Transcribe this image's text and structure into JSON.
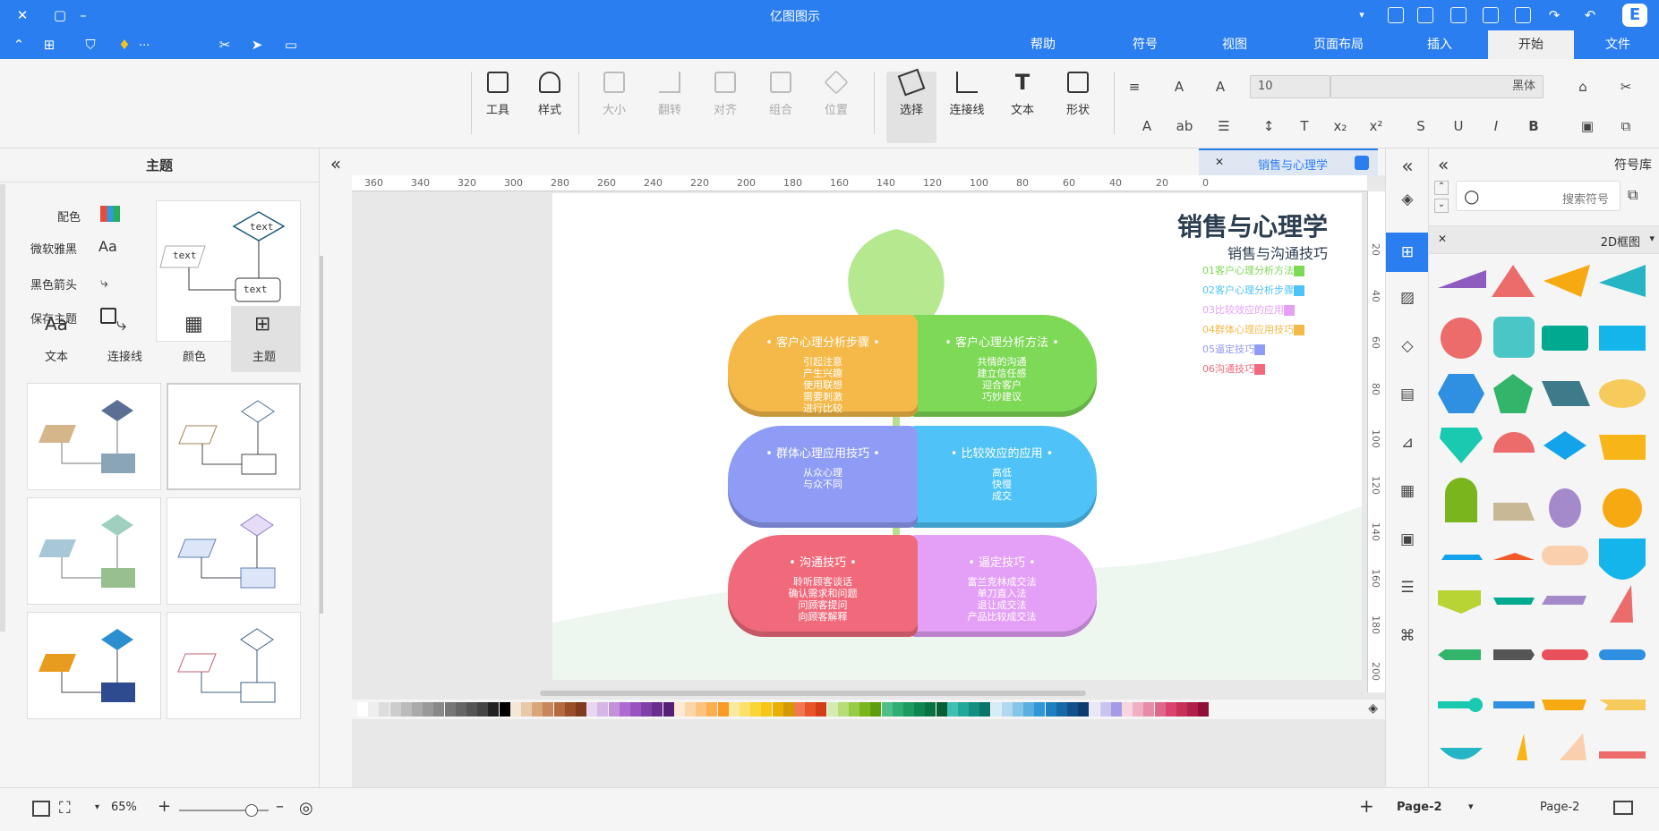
{
  "app": {
    "title": "亿图图示"
  },
  "titlebar": {
    "left_icons": [
      "close-icon",
      "maximize-icon",
      "minimize-icon"
    ]
  },
  "menu": {
    "items": [
      "文件",
      "开始",
      "插入",
      "页面布局",
      "视图",
      "符号",
      "帮助"
    ],
    "active": "开始",
    "more": "..."
  },
  "ribbon": {
    "font_name": "黑体",
    "font_size": "10",
    "buttons": [
      {
        "id": "shape",
        "label": "形状"
      },
      {
        "id": "text",
        "label": "文本"
      },
      {
        "id": "connector",
        "label": "连接线"
      },
      {
        "id": "select",
        "label": "选择"
      },
      {
        "id": "position",
        "label": "位置"
      },
      {
        "id": "group",
        "label": "组合"
      },
      {
        "id": "align",
        "label": "对齐"
      },
      {
        "id": "rotate",
        "label": "翻转"
      },
      {
        "id": "size",
        "label": "大小"
      },
      {
        "id": "style",
        "label": "样式"
      },
      {
        "id": "tools",
        "label": "工具"
      }
    ]
  },
  "right_panel": {
    "title": "符号库",
    "search_placeholder": "搜索符号",
    "category": "2D框图"
  },
  "left_panel": {
    "title": "主题",
    "theme_items": [
      "配色",
      "微软雅黑",
      "黑色箭头",
      "保存主题"
    ],
    "tabs": [
      "主题",
      "颜色",
      "连接线",
      "文本"
    ],
    "preview_texts": [
      "text",
      "text",
      "text"
    ]
  },
  "document": {
    "tab_label": "销售与心理学",
    "page": "Page-2"
  },
  "diagram": {
    "title": "销售与心理学",
    "subtitle": "销售与沟通技巧",
    "legend": [
      {
        "label": "01客户心理分析方法",
        "color": "#7ed957"
      },
      {
        "label": "02客户心理分析步骤",
        "color": "#4fc3f7"
      },
      {
        "label": "03比较效应的应用",
        "color": "#e4a0f7"
      },
      {
        "label": "04群体心理应用技巧",
        "color": "#f5b94a"
      },
      {
        "label": "05逼定技巧",
        "color": "#8f9cf5"
      },
      {
        "label": "06沟通技巧",
        "color": "#f06a7c"
      }
    ],
    "leaves": [
      {
        "title": "客户心理分析方法",
        "body": "共情的沟通\n建立信任感\n迎合客户\n巧妙建议",
        "color": "#7ed957"
      },
      {
        "title": "客户心理分析步骤",
        "body": "引起注意\n产生兴趣\n使用联想\n需要刺激\n进行比较",
        "color": "#f5b94a"
      },
      {
        "title": "比较效应的应用",
        "body": "高低\n快慢\n成交",
        "color": "#4fc3f7"
      },
      {
        "title": "群体心理应用技巧",
        "body": "从众心理\n与众不同",
        "color": "#8f9cf5"
      },
      {
        "title": "逼定技巧",
        "body": "富兰克林成交法\n单刀直入法\n退让成交法\n产品比较成交法",
        "color": "#e4a0f7"
      },
      {
        "title": "沟通技巧",
        "body": "聆听顾客谈话\n确认需求和问题\n问顾客提问\n向顾客解释",
        "color": "#f06a7c"
      }
    ]
  },
  "ruler": {
    "top": [
      "0",
      "20",
      "40",
      "60",
      "80",
      "100",
      "120",
      "140",
      "160",
      "180",
      "200",
      "220",
      "240",
      "260",
      "280",
      "300",
      "320",
      "340",
      "360"
    ],
    "left": [
      "20",
      "40",
      "60",
      "80",
      "100",
      "120",
      "140",
      "160",
      "180",
      "200"
    ]
  },
  "status": {
    "page_label": "Page-2",
    "page_tab": "Page-2",
    "add": "+",
    "zoom": "65%"
  }
}
